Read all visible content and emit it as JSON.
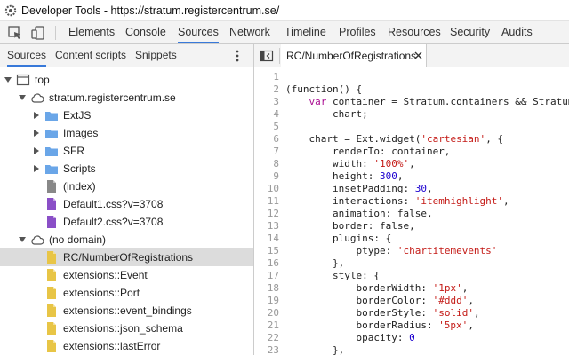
{
  "window": {
    "title": "Developer Tools - https://stratum.registercentrum.se/"
  },
  "main_tabs": [
    "Elements",
    "Console",
    "Sources",
    "Network",
    "Timeline",
    "Profiles",
    "Resources",
    "Security",
    "Audits"
  ],
  "active_main_tab": "Sources",
  "navigator_tabs": [
    "Sources",
    "Content scripts",
    "Snippets"
  ],
  "active_navigator_tab": "Sources",
  "tree": [
    {
      "label": "top",
      "icon": "frame-icon",
      "expanded": true
    },
    {
      "label": "stratum.registercentrum.se",
      "icon": "cloud-icon",
      "expanded": true
    },
    {
      "label": "ExtJS",
      "icon": "folder-icon",
      "expanded": false
    },
    {
      "label": "Images",
      "icon": "folder-icon",
      "expanded": false
    },
    {
      "label": "SFR",
      "icon": "folder-icon",
      "expanded": false
    },
    {
      "label": "Scripts",
      "icon": "folder-icon",
      "expanded": false
    },
    {
      "label": "(index)",
      "icon": "document-icon"
    },
    {
      "label": "Default1.css?v=3708",
      "icon": "stylesheet-icon"
    },
    {
      "label": "Default2.css?v=3708",
      "icon": "stylesheet-icon"
    },
    {
      "label": "(no domain)",
      "icon": "cloud-icon",
      "expanded": true
    },
    {
      "label": "RC/NumberOfRegistrations",
      "icon": "script-icon",
      "selected": true
    },
    {
      "label": "extensions::Event",
      "icon": "script-icon"
    },
    {
      "label": "extensions::Port",
      "icon": "script-icon"
    },
    {
      "label": "extensions::event_bindings",
      "icon": "script-icon"
    },
    {
      "label": "extensions::json_schema",
      "icon": "script-icon"
    },
    {
      "label": "extensions::lastError",
      "icon": "script-icon"
    }
  ],
  "editor": {
    "tab_label": "RC/NumberOfRegistrations",
    "line_numbers": [
      "1",
      "2",
      "3",
      "4",
      "5",
      "6",
      "7",
      "8",
      "9",
      "10",
      "11",
      "12",
      "13",
      "14",
      "15",
      "16",
      "17",
      "18",
      "19",
      "20",
      "21",
      "22",
      "23"
    ],
    "lines": [
      [],
      [
        {
          "t": "(function() {"
        }
      ],
      [
        {
          "t": "    "
        },
        {
          "t": "var",
          "c": "kw"
        },
        {
          "t": " container = Stratum.containers && Stratum"
        }
      ],
      [
        {
          "t": "        chart;"
        }
      ],
      [],
      [
        {
          "t": "    chart = Ext.widget("
        },
        {
          "t": "'cartesian'",
          "c": "str"
        },
        {
          "t": ", {"
        }
      ],
      [
        {
          "t": "        renderTo: container,"
        }
      ],
      [
        {
          "t": "        width: "
        },
        {
          "t": "'100%'",
          "c": "str"
        },
        {
          "t": ","
        }
      ],
      [
        {
          "t": "        height: "
        },
        {
          "t": "300",
          "c": "num"
        },
        {
          "t": ","
        }
      ],
      [
        {
          "t": "        insetPadding: "
        },
        {
          "t": "30",
          "c": "num"
        },
        {
          "t": ","
        }
      ],
      [
        {
          "t": "        interactions: "
        },
        {
          "t": "'itemhighlight'",
          "c": "str"
        },
        {
          "t": ","
        }
      ],
      [
        {
          "t": "        animation: false,"
        }
      ],
      [
        {
          "t": "        border: false,"
        }
      ],
      [
        {
          "t": "        plugins: {"
        }
      ],
      [
        {
          "t": "            ptype: "
        },
        {
          "t": "'chartitemevents'",
          "c": "str"
        }
      ],
      [
        {
          "t": "        },"
        }
      ],
      [
        {
          "t": "        style: {"
        }
      ],
      [
        {
          "t": "            borderWidth: "
        },
        {
          "t": "'1px'",
          "c": "str"
        },
        {
          "t": ","
        }
      ],
      [
        {
          "t": "            borderColor: "
        },
        {
          "t": "'#ddd'",
          "c": "str"
        },
        {
          "t": ","
        }
      ],
      [
        {
          "t": "            borderStyle: "
        },
        {
          "t": "'solid'",
          "c": "str"
        },
        {
          "t": ","
        }
      ],
      [
        {
          "t": "            borderRadius: "
        },
        {
          "t": "'5px'",
          "c": "str"
        },
        {
          "t": ","
        }
      ],
      [
        {
          "t": "            opacity: "
        },
        {
          "t": "0",
          "c": "num"
        }
      ],
      [
        {
          "t": "        },"
        }
      ]
    ]
  },
  "colors": {
    "accent": "#3879d9",
    "folder": "#6aa6e8",
    "script": "#e8c546",
    "stylesheet": "#8a4fc7",
    "document": "#888888",
    "keyword": "#aa0d91",
    "string": "#c41a16",
    "number": "#1c00cf"
  }
}
